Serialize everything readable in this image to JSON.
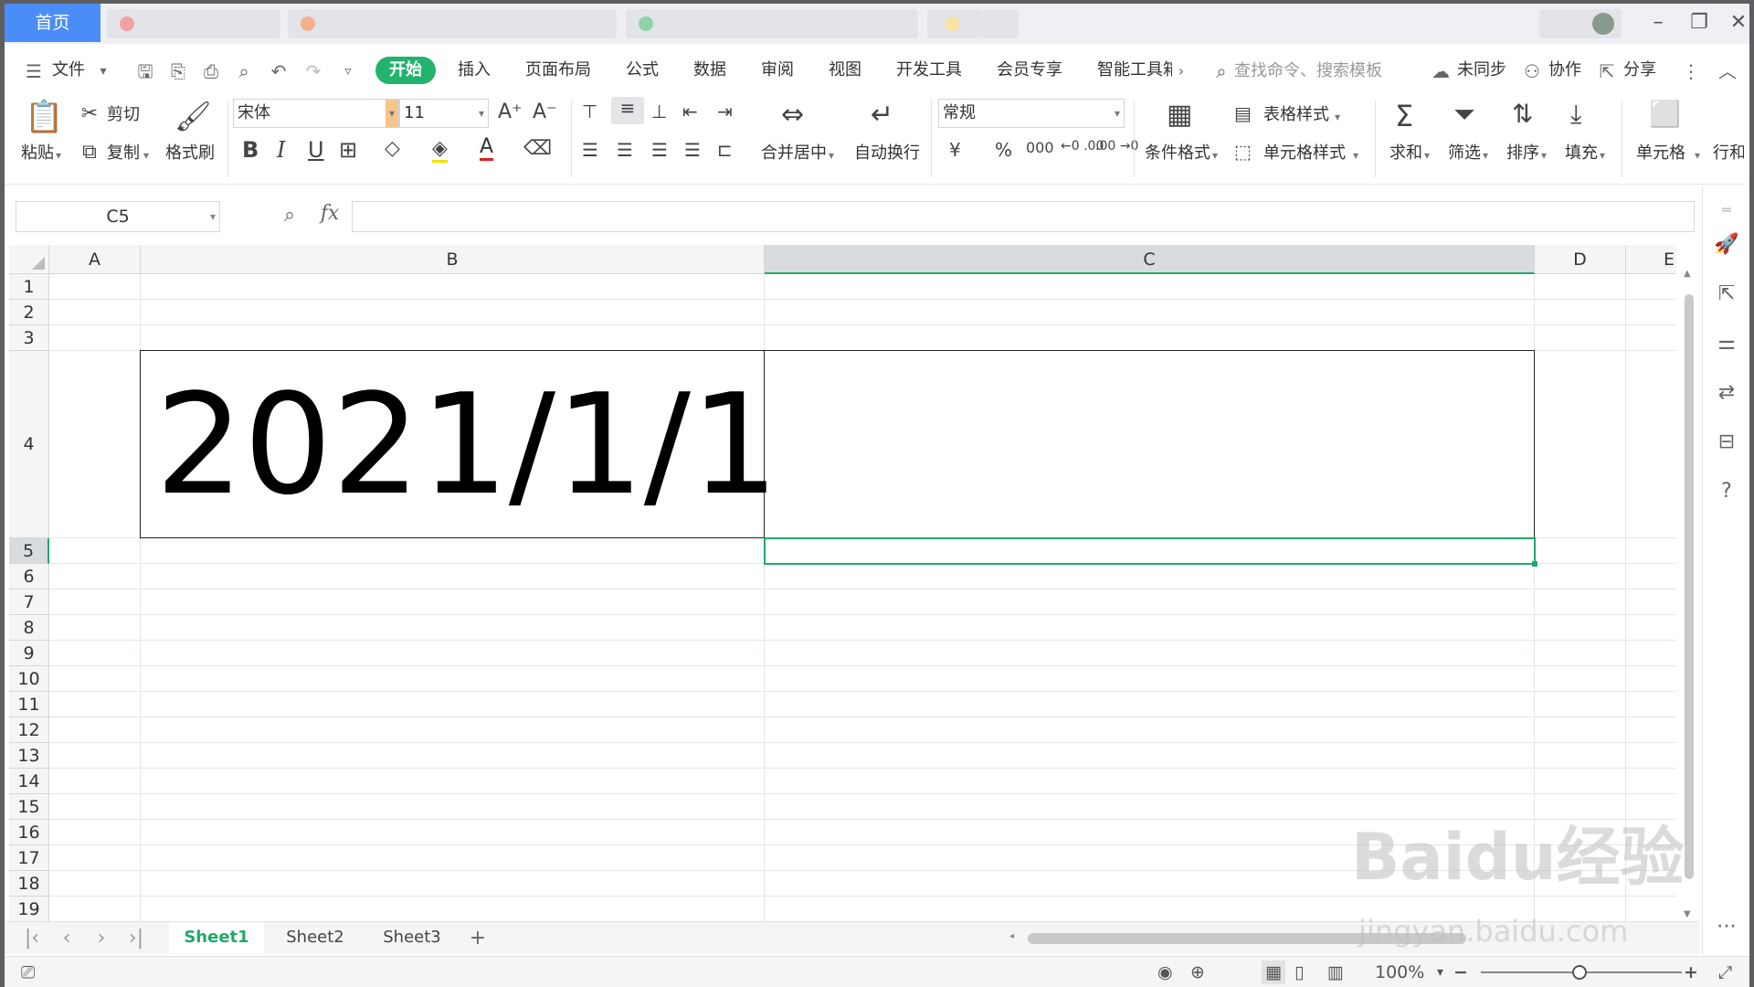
{
  "tabbar": {
    "home_tab": "首页"
  },
  "menu": {
    "file": "文件",
    "start": "开始",
    "items": [
      "插入",
      "页面布局",
      "公式",
      "数据",
      "审阅",
      "视图",
      "开发工具",
      "会员专享",
      "智能工具箱"
    ],
    "search_placeholder": "查找命令、搜索模板",
    "sync": "未同步",
    "collab": "协作",
    "share": "分享"
  },
  "ribbon": {
    "paste": "粘贴",
    "cut": "剪切",
    "copy": "复制",
    "format_painter": "格式刷",
    "font_name": "宋体",
    "font_size": "11",
    "merge_center": "合并居中",
    "wrap_text": "自动换行",
    "number_format": "常规",
    "conditional_format": "条件格式",
    "table_style": "表格样式",
    "cell_style": "单元格样式",
    "sum": "求和",
    "filter": "筛选",
    "sort": "排序",
    "fill": "填充",
    "cell": "单元格",
    "rows_cols": "行和"
  },
  "formula_bar": {
    "cell_ref": "C5",
    "fx": "fx",
    "value": ""
  },
  "grid": {
    "columns": [
      "A",
      "B",
      "C",
      "D",
      "E"
    ],
    "rows": [
      "1",
      "2",
      "3",
      "4",
      "5",
      "6",
      "7",
      "8",
      "9",
      "10",
      "11",
      "12",
      "13",
      "14",
      "15",
      "16",
      "17",
      "18",
      "19"
    ],
    "active_column": "C",
    "active_row": "5",
    "cell_B4": "2021/1/1"
  },
  "sheets": {
    "tabs": [
      "Sheet1",
      "Sheet2",
      "Sheet3"
    ],
    "active": "Sheet1"
  },
  "status": {
    "zoom": "100%"
  },
  "watermark": {
    "brand": "Baidu经验",
    "url": "jingyan.baidu.com"
  },
  "colors": {
    "accent_green": "#22a86b",
    "home_tab_blue": "#4a8df8"
  }
}
